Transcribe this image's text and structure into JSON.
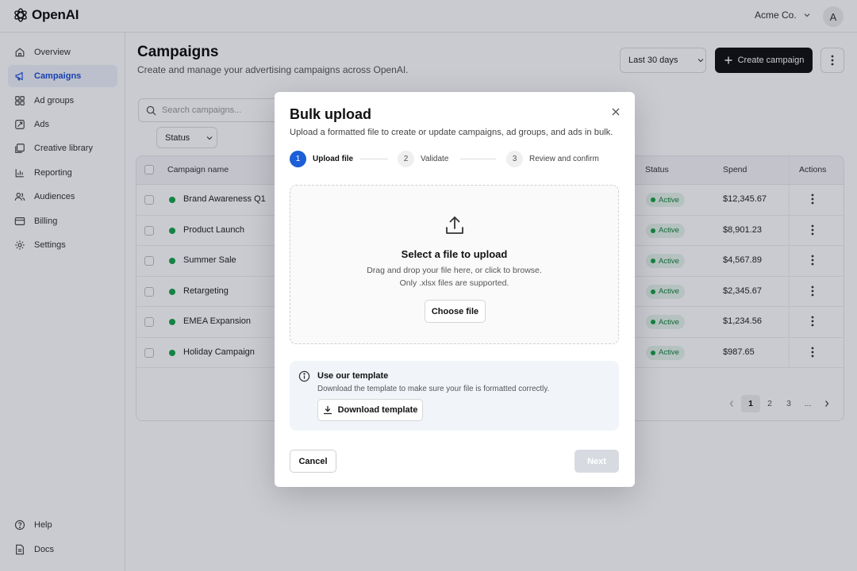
{
  "app": {
    "name": "OpenAI",
    "org": "Acme Co.",
    "avatar_initial": "A"
  },
  "sidebar": {
    "items": [
      {
        "label": "Overview",
        "icon": "home-icon"
      },
      {
        "label": "Campaigns",
        "icon": "megaphone-icon",
        "active": true
      },
      {
        "label": "Ad groups",
        "icon": "ad-groups-icon"
      },
      {
        "label": "Ads",
        "icon": "ads-icon"
      },
      {
        "label": "Creative library",
        "icon": "library-icon"
      },
      {
        "label": "Reporting",
        "icon": "chart-icon"
      },
      {
        "label": "Audiences",
        "icon": "users-icon"
      },
      {
        "label": "Billing",
        "icon": "credit-card-icon"
      },
      {
        "label": "Settings",
        "icon": "gear-icon"
      }
    ],
    "footer": [
      {
        "label": "Help",
        "icon": "help-icon"
      },
      {
        "label": "Docs",
        "icon": "docs-icon"
      }
    ]
  },
  "header": {
    "title": "Campaigns",
    "subtitle": "Create and manage your advertising campaigns across OpenAI.",
    "date_range": "Last 30 days",
    "create_label": "Create campaign"
  },
  "filters": {
    "search_placeholder": "Search campaigns...",
    "status_label": "Status"
  },
  "table": {
    "columns": {
      "name": "Campaign name",
      "status": "Status",
      "spend": "Spend",
      "actions": "Actions"
    },
    "rows": [
      {
        "name": "Brand Awareness Q1",
        "status": "Active",
        "spend": "$12,345.67"
      },
      {
        "name": "Product Launch",
        "status": "Active",
        "spend": "$8,901.23"
      },
      {
        "name": "Summer Sale",
        "status": "Active",
        "spend": "$4,567.89"
      },
      {
        "name": "Retargeting",
        "status": "Active",
        "spend": "$2,345.67"
      },
      {
        "name": "EMEA Expansion",
        "status": "Active",
        "spend": "$1,234.56"
      },
      {
        "name": "Holiday Campaign",
        "status": "Active",
        "spend": "$987.65"
      }
    ]
  },
  "pagination": {
    "pages": [
      "1",
      "2",
      "3",
      "..."
    ],
    "current": "1"
  },
  "modal": {
    "title": "Bulk upload",
    "subtitle": "Upload a formatted file to create or update campaigns, ad groups, and ads in bulk.",
    "steps": [
      {
        "num": "1",
        "label": "Upload file",
        "active": true
      },
      {
        "num": "2",
        "label": "Validate"
      },
      {
        "num": "3",
        "label": "Review and confirm"
      }
    ],
    "drop": {
      "title": "Select a file to upload",
      "line1": "Drag and drop your file here, or click to browse.",
      "line2": "Only .xlsx files are supported.",
      "button": "Choose file"
    },
    "template": {
      "title": "Use our template",
      "description": "Download the template to make sure your file is formatted correctly.",
      "button": "Download template"
    },
    "cancel_label": "Cancel",
    "next_label": "Next"
  },
  "colors": {
    "accent": "#1d5fd6",
    "success": "#16a34a",
    "primary_button": "#111111"
  }
}
